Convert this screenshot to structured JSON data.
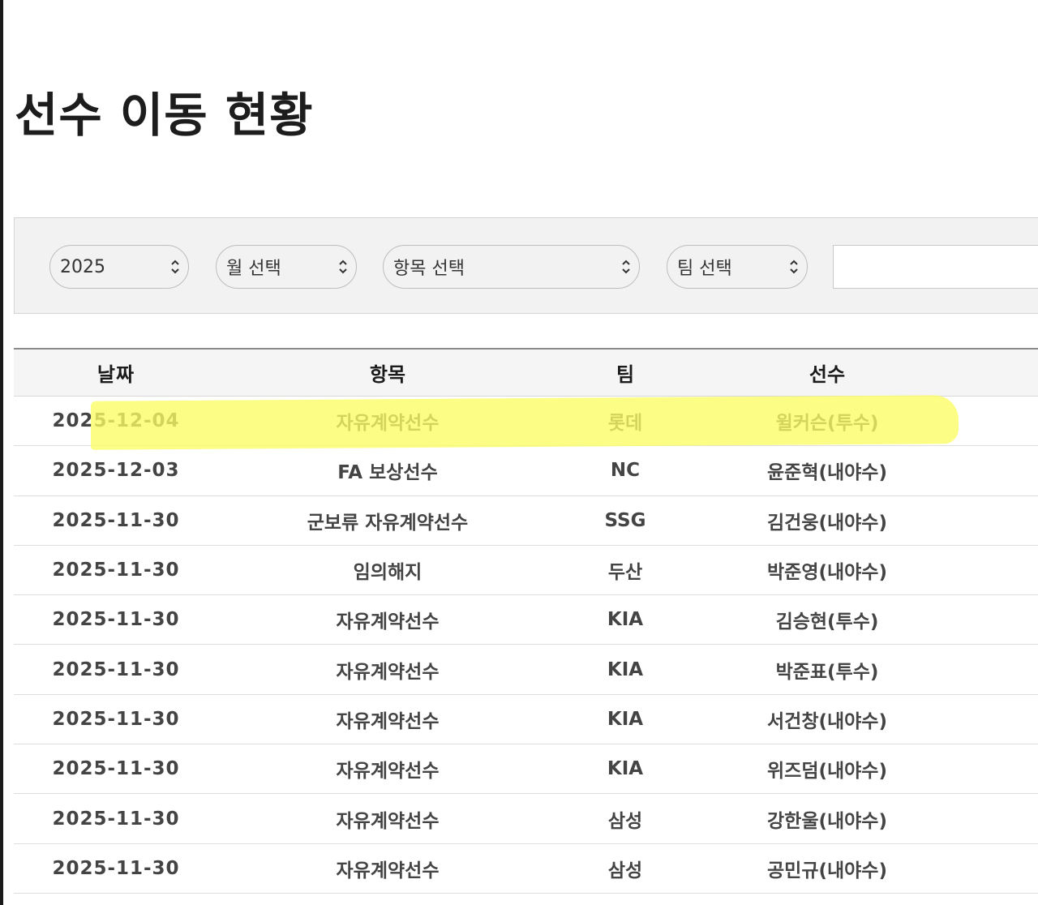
{
  "page": {
    "title": "선수 이동 현황"
  },
  "filters": {
    "year": "2025",
    "month": "월 선택",
    "category": "항목 선택",
    "team": "팀 선택",
    "search_value": ""
  },
  "table": {
    "headers": [
      "날짜",
      "항목",
      "팀",
      "선수"
    ],
    "rows": [
      [
        "2025-12-04",
        "자유계약선수",
        "롯데",
        "윌커슨(투수)"
      ],
      [
        "2025-12-03",
        "FA 보상선수",
        "NC",
        "윤준혁(내야수)"
      ],
      [
        "2025-11-30",
        "군보류 자유계약선수",
        "SSG",
        "김건웅(내야수)"
      ],
      [
        "2025-11-30",
        "임의해지",
        "두산",
        "박준영(내야수)"
      ],
      [
        "2025-11-30",
        "자유계약선수",
        "KIA",
        "김승현(투수)"
      ],
      [
        "2025-11-30",
        "자유계약선수",
        "KIA",
        "박준표(투수)"
      ],
      [
        "2025-11-30",
        "자유계약선수",
        "KIA",
        "서건창(내야수)"
      ],
      [
        "2025-11-30",
        "자유계약선수",
        "KIA",
        "위즈덤(내야수)"
      ],
      [
        "2025-11-30",
        "자유계약선수",
        "삼성",
        "강한울(내야수)"
      ],
      [
        "2025-11-30",
        "자유계약선수",
        "삼성",
        "공민규(내야수)"
      ]
    ]
  },
  "colors": {
    "highlight": "#fbfc63",
    "text": "#444444",
    "header_bg": "#f5f5f5",
    "filter_bg": "#f2f2f2"
  },
  "icons": {
    "select_chevron": "chevron-up-down-icon"
  }
}
